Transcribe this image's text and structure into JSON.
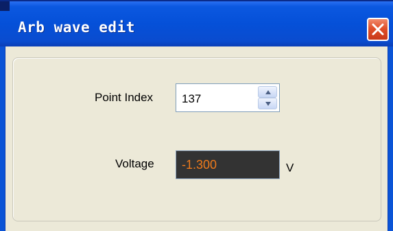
{
  "window": {
    "title": "Arb wave edit",
    "close_icon": "close-icon"
  },
  "form": {
    "point_index": {
      "label": "Point Index",
      "value": "137",
      "up_icon": "arrow-up-icon",
      "down_icon": "arrow-down-icon"
    },
    "voltage": {
      "label": "Voltage",
      "value": "-1.300",
      "unit": "V",
      "value_color": "#f07b1b",
      "background_color": "#333333"
    }
  },
  "colors": {
    "titlebar": "#0550d8",
    "close_button": "#e0502a",
    "client_background": "#ece9d8"
  }
}
